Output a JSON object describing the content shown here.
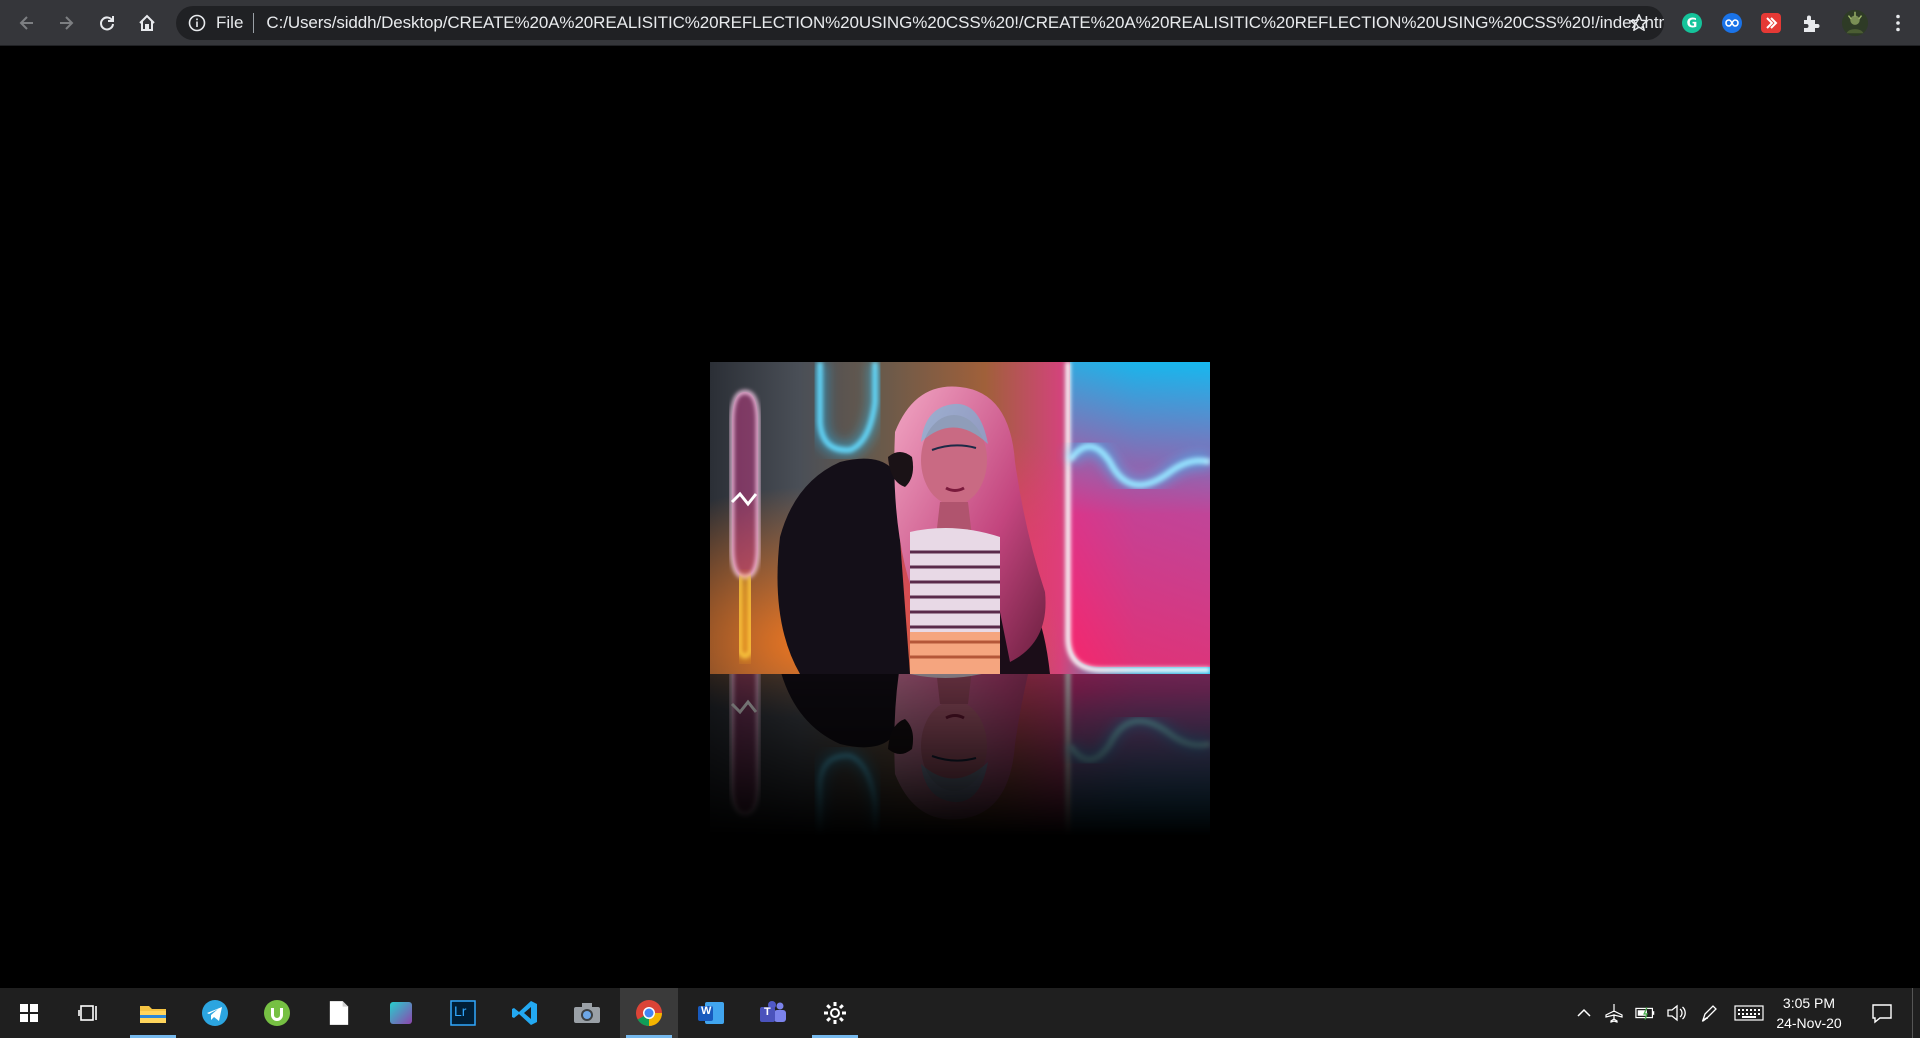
{
  "browser": {
    "scheme_label": "File",
    "url": "C:/Users/siddh/Desktop/CREATE%20A%20REALISITIC%20REFLECTION%20USING%20CSS%20!/CREATE%20A%20REALISITIC%20REFLECTION%20USING%20CSS%20!/index.html",
    "extensions": [
      "grammarly-icon",
      "loop-extension-icon",
      "red-extension-icon",
      "puzzle-icon"
    ]
  },
  "page": {
    "image_alt": "neon portrait",
    "background": "#000000"
  },
  "taskbar": {
    "apps": [
      "start-icon",
      "task-view-icon",
      "file-explorer-icon",
      "telegram-icon",
      "utorrent-icon",
      "notepad-icon",
      "app-icon",
      "lightroom-icon",
      "vscode-icon",
      "camera-icon",
      "chrome-icon",
      "word-icon",
      "teams-icon",
      "settings-icon"
    ],
    "lightroom_label": "Lr",
    "word_label": "W",
    "teams_label": "T",
    "clock_time": "3:05 PM",
    "clock_date": "24-Nov-20"
  },
  "colors": {
    "toolbar": "#35363a",
    "omnibox": "#202124",
    "taskbar": "#1f1f1f",
    "accent": "#76b9ed"
  }
}
